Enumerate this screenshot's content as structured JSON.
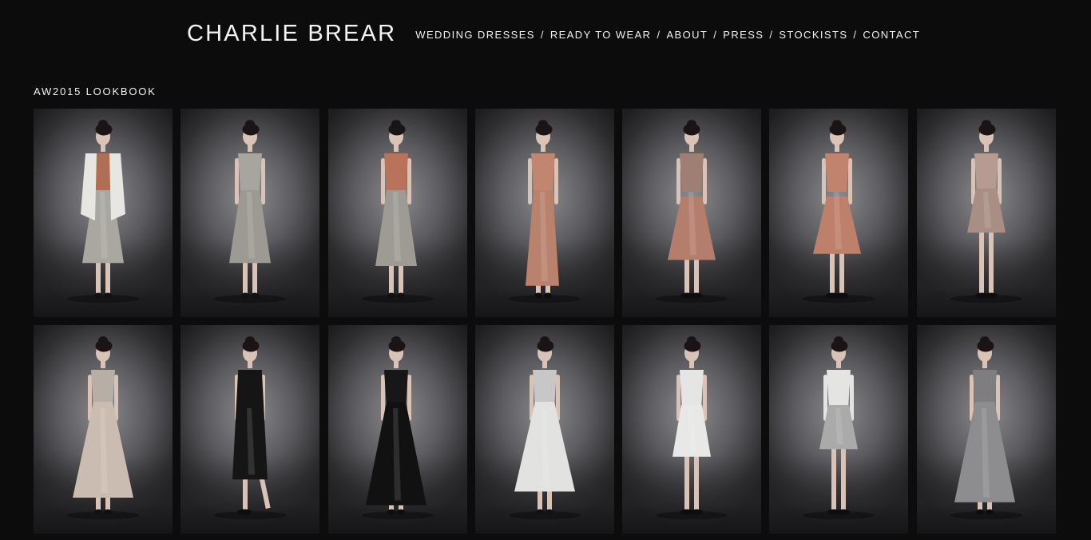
{
  "site": {
    "brand": "CHARLIE BREAR",
    "nav": [
      {
        "label": "WEDDING DRESSES"
      },
      {
        "label": "READY TO WEAR"
      },
      {
        "label": "ABOUT"
      },
      {
        "label": "PRESS"
      },
      {
        "label": "STOCKISTS"
      },
      {
        "label": "CONTACT"
      }
    ],
    "nav_separator": "/"
  },
  "section": {
    "title": "AW2015 LOOKBOOK"
  },
  "colors": {
    "background": "#0c0c0d",
    "text": "#f2f2f2"
  },
  "lookbook": [
    {
      "outfit": "white fur jacket, rust camisole, silver midi skirt",
      "colors": {
        "top": "#b06f55",
        "bottom": "#a9a7a0",
        "outer": "#e8e6e2"
      },
      "shoes": "strappy heels"
    },
    {
      "outfit": "silver sleeveless midi dress",
      "colors": {
        "top": "#a8a59e",
        "bottom": "#9d9a93",
        "outer": ""
      },
      "shoes": "strappy heels"
    },
    {
      "outfit": "rust camisole, silver midi skirt",
      "colors": {
        "top": "#b9735a",
        "bottom": "#9e9b94",
        "outer": ""
      },
      "shoes": "strappy heels"
    },
    {
      "outfit": "rose copper satin gown",
      "colors": {
        "top": "#c08670",
        "bottom": "#b9826c",
        "outer": ""
      },
      "shoes": ""
    },
    {
      "outfit": "rose sequin drop-waist dress",
      "colors": {
        "top": "#9f7f74",
        "bottom": "#b57e6c",
        "outer": ""
      },
      "shoes": "brogues"
    },
    {
      "outfit": "copper satin shirt dress",
      "colors": {
        "top": "#c2836e",
        "bottom": "#bd806a",
        "outer": ""
      },
      "shoes": "brogues"
    },
    {
      "outfit": "sequin strapless mini dress",
      "colors": {
        "top": "#b59b92",
        "bottom": "#a88e85",
        "outer": ""
      },
      "shoes": "brogues"
    },
    {
      "outfit": "sequin bodice blush gown",
      "colors": {
        "top": "#b7aea6",
        "bottom": "#cbbcb2",
        "outer": ""
      },
      "shoes": "strappy heels"
    },
    {
      "outfit": "black smock dress",
      "colors": {
        "top": "#141414",
        "bottom": "#151515",
        "outer": ""
      },
      "shoes": "brogues"
    },
    {
      "outfit": "black sheer off-shoulder gown",
      "colors": {
        "top": "#171717",
        "bottom": "#111111",
        "outer": ""
      },
      "shoes": ""
    },
    {
      "outfit": "white lace dress with silver bodice",
      "colors": {
        "top": "#c7c7c7",
        "bottom": "#e2e2e0",
        "outer": ""
      },
      "shoes": "strappy heels"
    },
    {
      "outfit": "white lace ruffle-hem dress",
      "colors": {
        "top": "#e5e5e3",
        "bottom": "#e8e8e6",
        "outer": ""
      },
      "shoes": "brogues"
    },
    {
      "outfit": "white sweater, silver ruffle skirt",
      "colors": {
        "top": "#e4e4e2",
        "bottom": "#aaaaaa",
        "outer": ""
      },
      "shoes": "brogues"
    },
    {
      "outfit": "silver metallic gown",
      "colors": {
        "top": "#7e7e80",
        "bottom": "#8d8d90",
        "outer": ""
      },
      "shoes": ""
    }
  ]
}
